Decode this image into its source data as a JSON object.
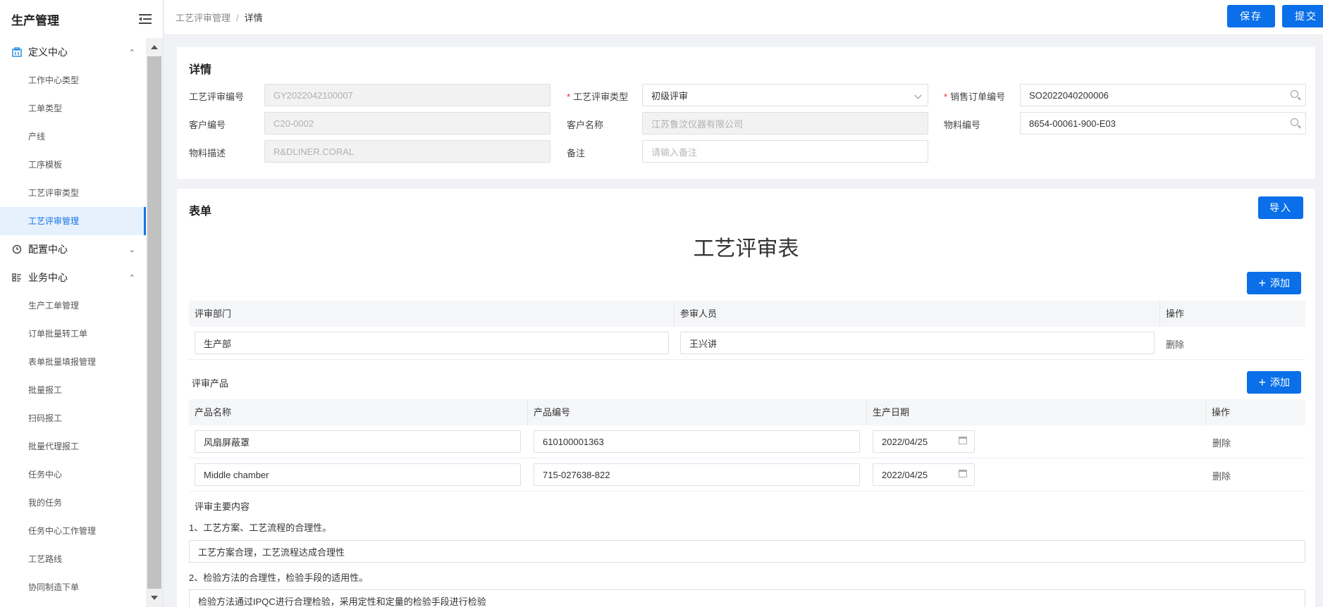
{
  "sidebar": {
    "title": "生产管理",
    "groups": [
      {
        "label": "定义中心",
        "items": [
          "工作中心类型",
          "工单类型",
          "产线",
          "工序模板",
          "工艺评审类型",
          "工艺评审管理"
        ]
      },
      {
        "label": "配置中心"
      },
      {
        "label": "业务中心",
        "items": [
          "生产工单管理",
          "订单批量转工单",
          "表单批量填报管理",
          "批量报工",
          "扫码报工",
          "批量代理报工",
          "任务中心",
          "我的任务",
          "任务中心工作管理",
          "工艺路线",
          "协同制造下单"
        ]
      }
    ]
  },
  "breadcrumb": {
    "parent": "工艺评审管理",
    "separator": "/",
    "current": "详情"
  },
  "actions": {
    "save": "保存",
    "submit": "提交"
  },
  "detail": {
    "title": "详情",
    "review_no_label": "工艺评审编号",
    "review_no": "GY2022042100007",
    "review_type_label": "工艺评审类型",
    "review_type": "初级评审",
    "sales_order_label": "销售订单编号",
    "sales_order": "SO2022040200006",
    "customer_no_label": "客户编号",
    "customer_no": "C20-0002",
    "customer_name_label": "客户名称",
    "customer_name": "江苏鲁汶仪器有限公司",
    "material_no_label": "物料编号",
    "material_no": "8654-00061-900-E03",
    "material_desc_label": "物料描述",
    "material_desc": "R&DLINER.CORAL",
    "remark_label": "备注",
    "remark_placeholder": "请输入备注"
  },
  "form": {
    "title": "表单",
    "import": "导入",
    "heading": "工艺评审表",
    "add": "添加",
    "dept_table": {
      "headers": [
        "评审部门",
        "参审人员",
        "操作"
      ],
      "rows": [
        {
          "dept": "生产部",
          "person": "王兴讲",
          "op": "删除"
        }
      ]
    },
    "product_title": "评审产品",
    "product_table": {
      "headers": [
        "产品名称",
        "产品编号",
        "生产日期",
        "操作"
      ],
      "rows": [
        {
          "name": "风扇屏蔽罩",
          "code": "610100001363",
          "date": "2022/04/25",
          "op": "删除"
        },
        {
          "name": "Middle chamber",
          "code": "715-027638-822",
          "date": "2022/04/25",
          "op": "删除"
        }
      ]
    },
    "content_title": "评审主要内容",
    "q1": "1、工艺方案、工艺流程的合理性。",
    "a1": "工艺方案合理，工艺流程达成合理性",
    "q2": "2、检验方法的合理性，检验手段的适用性。",
    "a2": "检验方法通过IPQC进行合理检验，采用定性和定量的检验手段进行检验"
  }
}
